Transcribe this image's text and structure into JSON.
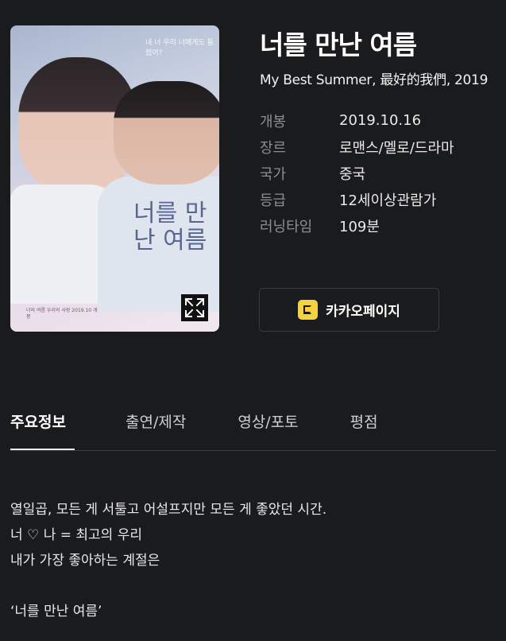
{
  "poster": {
    "alt_title_art": "너를 만난 여름",
    "tagline": "내 너 우리 너에게도 들렸어?",
    "credit": "너의 여름 우리의 사랑 2019.10 개봉"
  },
  "movie": {
    "title": "너를 만난 여름",
    "subtitle": "My Best Summer, 最好的我們, 2019",
    "info": [
      {
        "label": "개봉",
        "value": "2019.10.16"
      },
      {
        "label": "장르",
        "value": "로맨스/멜로/드라마"
      },
      {
        "label": "국가",
        "value": "중국"
      },
      {
        "label": "등급",
        "value": "12세이상관람가"
      },
      {
        "label": "러닝타임",
        "value": "109분"
      }
    ]
  },
  "kakao_button": {
    "label": "카카오페이지",
    "icon": "kakaopage-icon",
    "accent": "#f7d23c"
  },
  "tabs": [
    {
      "label": "주요정보",
      "active": true
    },
    {
      "label": "출연/제작",
      "active": false
    },
    {
      "label": "영상/포토",
      "active": false
    },
    {
      "label": "평점",
      "active": false
    }
  ],
  "synopsis": [
    "열일곱, 모든 게 서툴고 어설프지만 모든 게 좋았던 시간.",
    "너 ♡ 나 = 최고의 우리",
    "내가 가장 좋아하는 계절은",
    "",
    "‘너를 만난 여름’"
  ],
  "colors": {
    "background": "#1a1b1d",
    "text": "#e9e9ea",
    "muted": "#8d8e91",
    "border": "#3a3b3e"
  }
}
